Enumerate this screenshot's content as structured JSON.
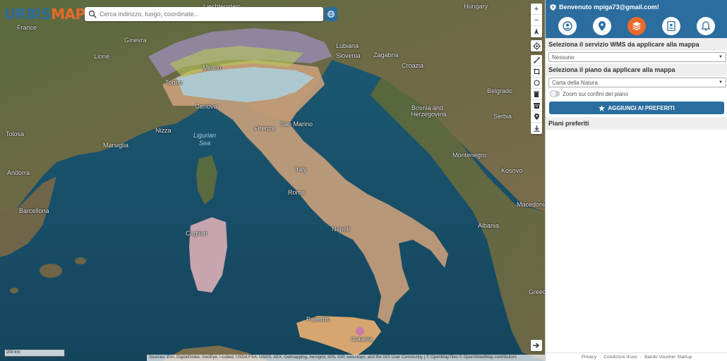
{
  "app": {
    "logo_part1": "URBIS",
    "logo_part2": "MAP",
    "brand_color": "#2a6d9e",
    "accent_color": "#ea6a2b"
  },
  "search": {
    "placeholder": "Cerca indirizzo, luogo, coordinate...",
    "icon": "search-icon",
    "globe_icon": "globe-icon"
  },
  "map_controls": {
    "zoom_in": "+",
    "zoom_out": "−",
    "compass": "▲"
  },
  "map_labels": {
    "cities": [
      {
        "name": "Hungary"
      },
      {
        "name": "Liechtenstein"
      },
      {
        "name": "France"
      },
      {
        "name": "Ginevra"
      },
      {
        "name": "Lione"
      },
      {
        "name": "Lubiana"
      },
      {
        "name": "Slovenia"
      },
      {
        "name": "Zagabria"
      },
      {
        "name": "Croazia"
      },
      {
        "name": "Milano"
      },
      {
        "name": "Torino"
      },
      {
        "name": "Genova"
      },
      {
        "name": "Belgrado"
      },
      {
        "name": "Bosnia and"
      },
      {
        "name": "Herzegovina"
      },
      {
        "name": "Serbia"
      },
      {
        "name": "Tolosa"
      },
      {
        "name": "Nizza"
      },
      {
        "name": "Marsiglia"
      },
      {
        "name": "Firenze"
      },
      {
        "name": "San Marino"
      },
      {
        "name": "Montenegro"
      },
      {
        "name": "Kosovo"
      },
      {
        "name": "Andorra"
      },
      {
        "name": "Italy"
      },
      {
        "name": "Roma"
      },
      {
        "name": "Barcellona"
      },
      {
        "name": "Macedonia"
      },
      {
        "name": "Napoli"
      },
      {
        "name": "Albania"
      },
      {
        "name": "Cagliari"
      },
      {
        "name": "Greece"
      },
      {
        "name": "Palermo"
      },
      {
        "name": "Catania"
      }
    ],
    "sea_line1": "Ligurian",
    "sea_line2": "Sea"
  },
  "scale": "200 km",
  "attribution": "Sources: Esri, DigitalGlobe, GeoEye, i-cubed, USDA FSA, USGS, AEX, Getmapping, Aerogrid, IGN, IGP, swisstopo, and the GIS User Community | © OpenMapTiles © OpenStreetMap contributors",
  "panel": {
    "welcome": "Benvenuto mpiga73@gmail.com!",
    "tabs": [
      {
        "icon": "user-icon",
        "active": false
      },
      {
        "icon": "map-pin-icon",
        "active": false
      },
      {
        "icon": "layers-icon",
        "active": true
      },
      {
        "icon": "contacts-icon",
        "active": false
      },
      {
        "icon": "bell-icon",
        "active": false
      }
    ],
    "wms_title": "Seleziona il servizio WMS da applicare alla mappa",
    "wms_value": "Nessuno",
    "plan_title": "Seleziona il piano da applicare alla mappa",
    "plan_value": "Carta della Natura",
    "zoom_toggle_label": "Zoom sui confini del piano",
    "zoom_toggle_on": false,
    "fav_button": "AGGIUNGI AI PREFERITI",
    "fav_title": "Piani preferiti"
  },
  "footer": {
    "privacy": "Privacy",
    "sep1": "·",
    "terms": "Condizioni d'uso",
    "sep2": "·",
    "voucher": "Bando Voucher Startup"
  }
}
